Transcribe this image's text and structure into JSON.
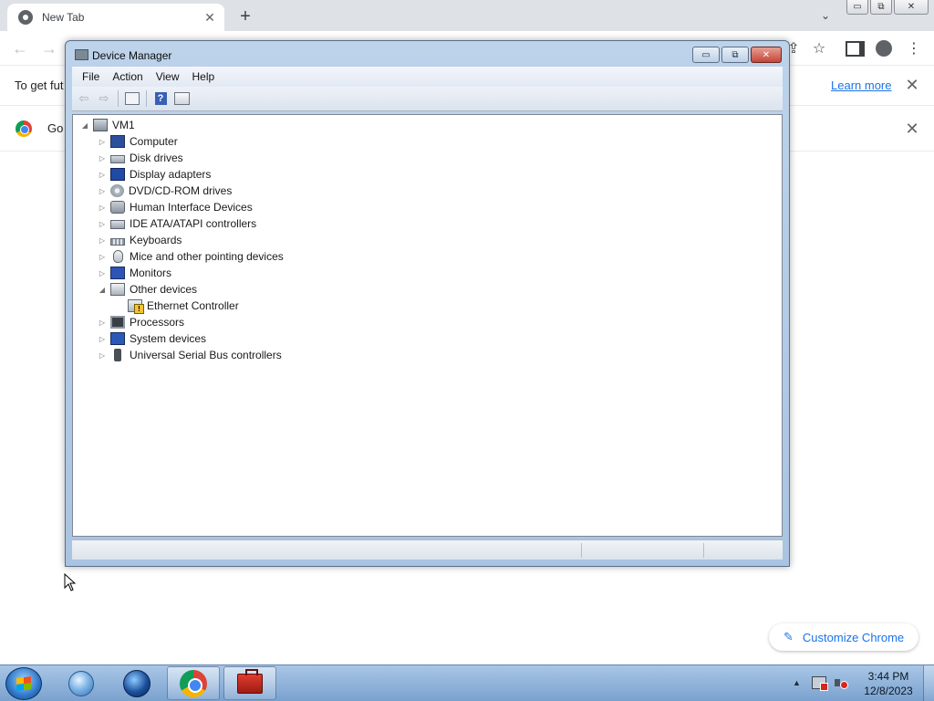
{
  "chrome": {
    "tab_title": "New Tab",
    "tab_close": "✕",
    "new_tab": "+",
    "tab_search": "⌄",
    "window_buttons": {
      "minimize": "▭",
      "restore": "⧉",
      "close": "✕"
    },
    "nav": {
      "back": "←",
      "forward": "→"
    },
    "toolbar_icons": {
      "share": "⇪",
      "star": "☆",
      "menu": "⋮"
    },
    "infobar_text": "To get fut",
    "learn_more": "Learn more",
    "infobar_close": "✕",
    "infobar2_text": "Go",
    "infobar2_close": "✕",
    "customize_label": "Customize Chrome",
    "customize_icon": "✎"
  },
  "device_manager": {
    "title": "Device Manager",
    "controls": {
      "minimize": "▭",
      "maximize": "⧉",
      "close": "✕"
    },
    "menu": [
      "File",
      "Action",
      "View",
      "Help"
    ],
    "toolbar": {
      "back": "⇦",
      "forward": "⇨"
    },
    "tree": {
      "root": {
        "label": "VM1",
        "toggle": "◢",
        "icon": "computer-root-icon"
      },
      "nodes": [
        {
          "label": "Computer",
          "toggle": "▷",
          "icon": "computer-icon"
        },
        {
          "label": "Disk drives",
          "toggle": "▷",
          "icon": "disk-drive-icon"
        },
        {
          "label": "Display adapters",
          "toggle": "▷",
          "icon": "display-adapter-icon"
        },
        {
          "label": "DVD/CD-ROM drives",
          "toggle": "▷",
          "icon": "dvd-drive-icon"
        },
        {
          "label": "Human Interface Devices",
          "toggle": "▷",
          "icon": "hid-icon"
        },
        {
          "label": "IDE ATA/ATAPI controllers",
          "toggle": "▷",
          "icon": "ide-controller-icon"
        },
        {
          "label": "Keyboards",
          "toggle": "▷",
          "icon": "keyboard-icon"
        },
        {
          "label": "Mice and other pointing devices",
          "toggle": "▷",
          "icon": "mouse-icon"
        },
        {
          "label": "Monitors",
          "toggle": "▷",
          "icon": "monitor-icon"
        },
        {
          "label": "Other devices",
          "toggle": "◢",
          "icon": "other-devices-icon"
        },
        {
          "label": "Ethernet Controller",
          "toggle": "",
          "icon": "warning-device-icon",
          "child": true
        },
        {
          "label": "Processors",
          "toggle": "▷",
          "icon": "processor-icon"
        },
        {
          "label": "System devices",
          "toggle": "▷",
          "icon": "system-devices-icon"
        },
        {
          "label": "Universal Serial Bus controllers",
          "toggle": "▷",
          "icon": "usb-icon"
        }
      ]
    }
  },
  "taskbar": {
    "apps": [
      "internet-explorer",
      "globe-app",
      "google-chrome",
      "device-manager-toolbox"
    ],
    "clock_time": "3:44 PM",
    "clock_date": "12/8/2023",
    "tray_arrow": "▲"
  },
  "colors": {
    "chrome_link": "#1a73e8",
    "taskbar_top": "#a9c6e6",
    "window_frame": "#bcd3ea"
  }
}
